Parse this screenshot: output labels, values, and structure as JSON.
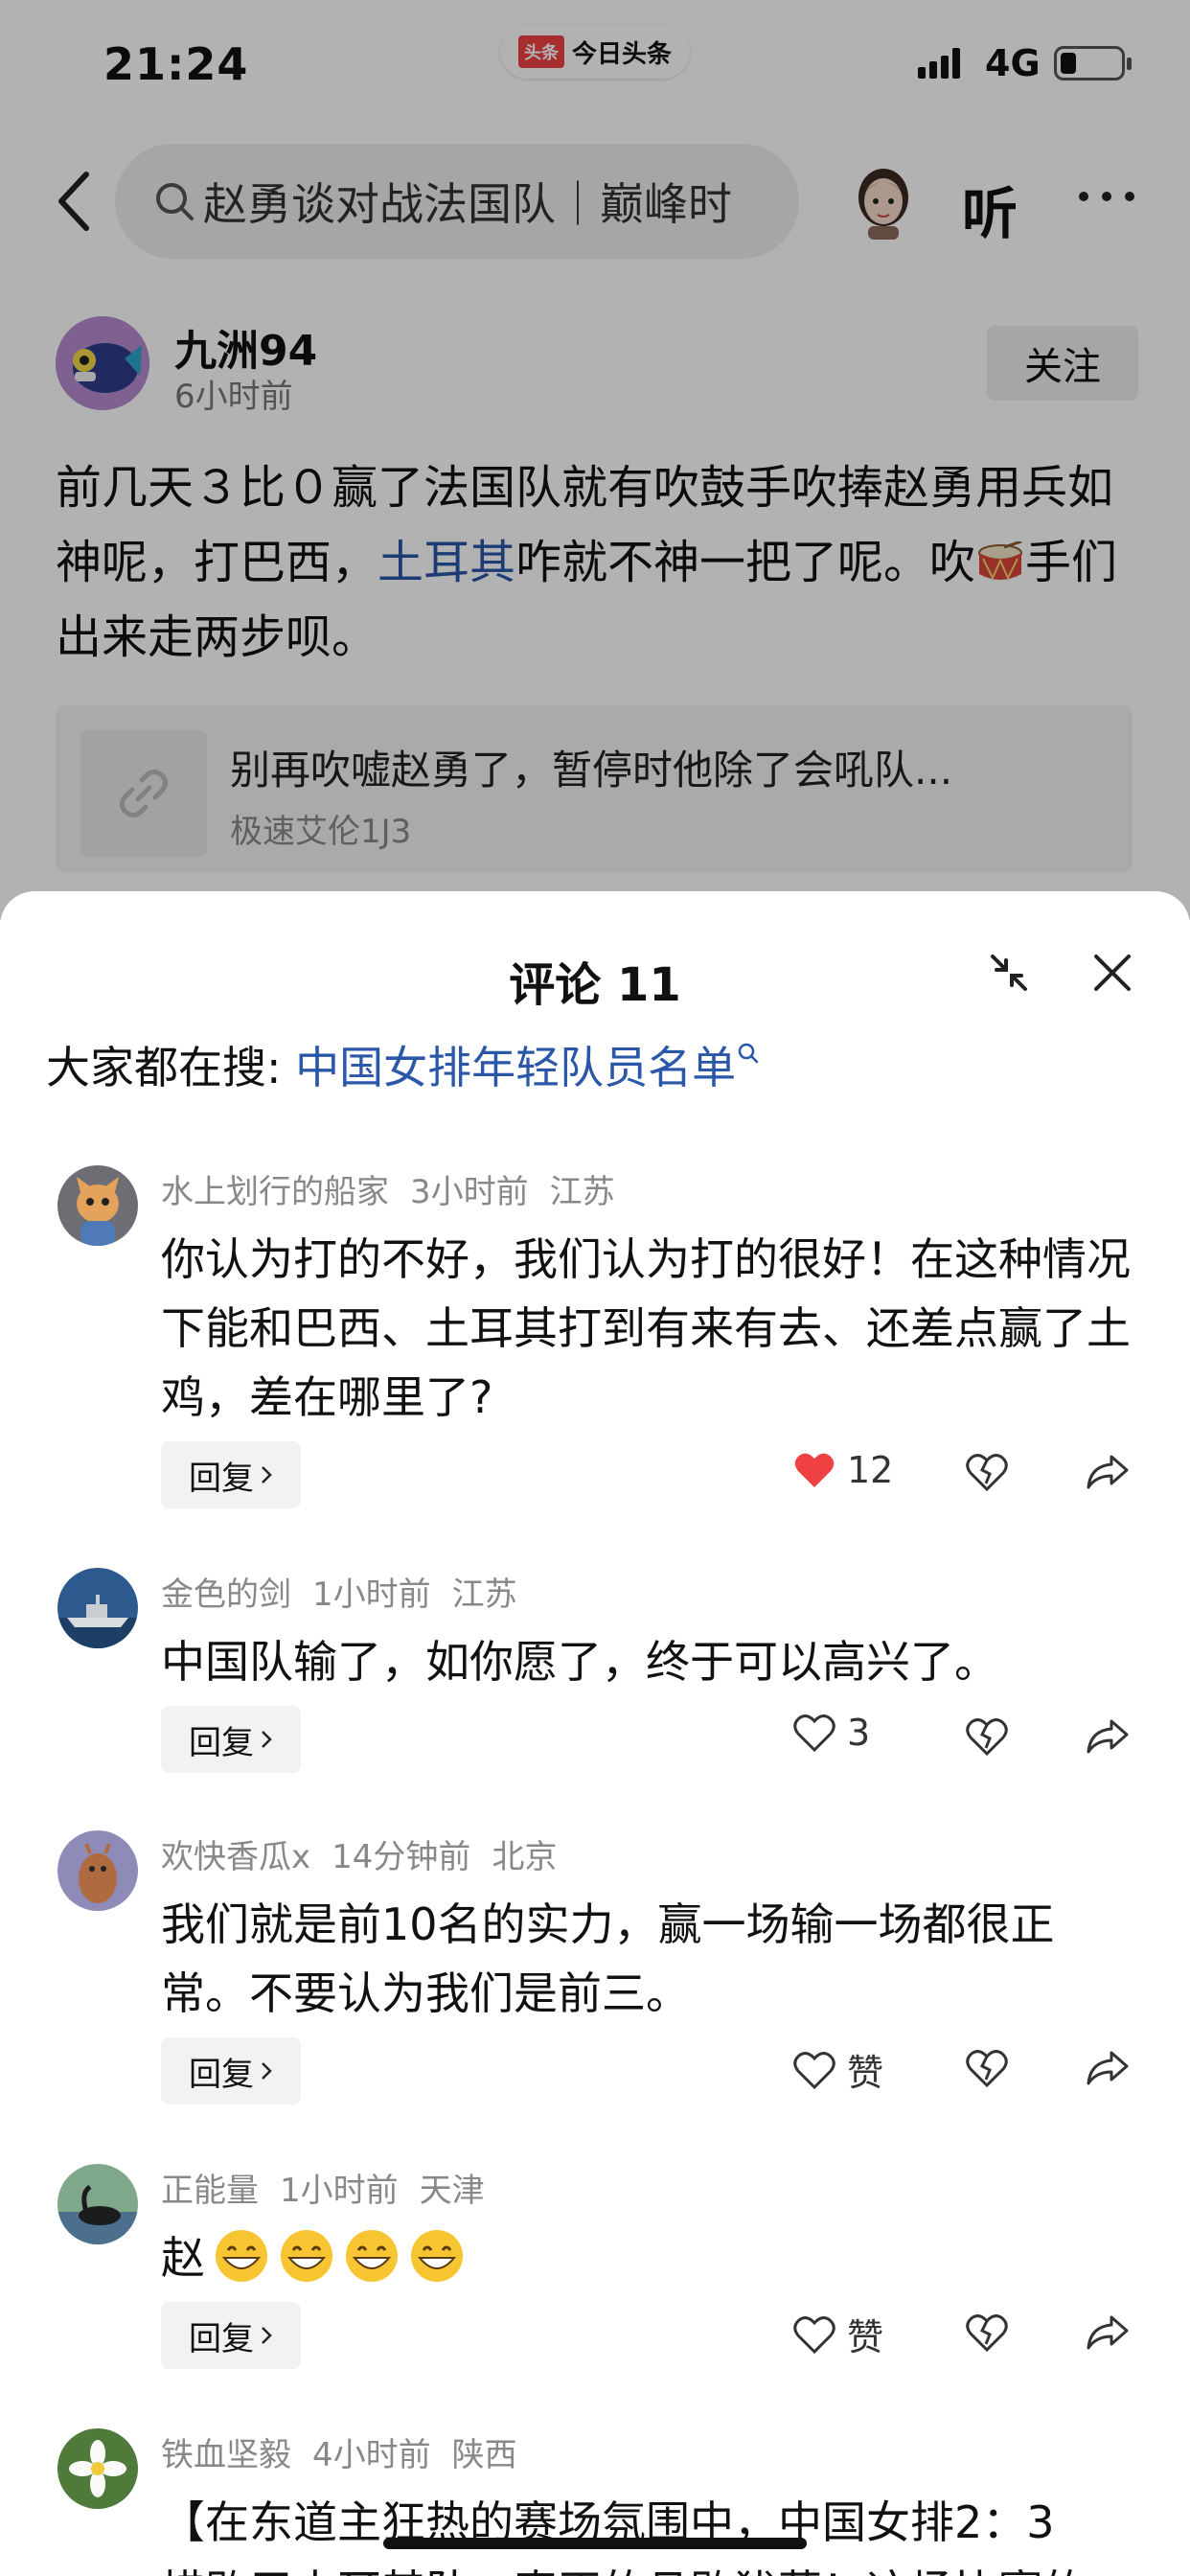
{
  "status_bar": {
    "time": "21:24",
    "app_logo": "头条",
    "app_name": "今日头条",
    "network": "4G",
    "battery_level": 0.2
  },
  "nav": {
    "search_text": "赵勇谈对战法国队｜巅峰时",
    "listen_label": "听",
    "icons": [
      "back-icon",
      "search-icon",
      "more-icon"
    ]
  },
  "post": {
    "author_name": "九洲94",
    "time": "6小时前",
    "follow_label": "关注",
    "text_part1": "前几天３比０赢了法国队就有吹鼓手吹捧赵勇用兵如神呢，打巴西，",
    "link_text": "土耳其",
    "text_part2": "咋就不神一把了呢。吹",
    "text_part3": "手们出来走两步呗。",
    "card_title": "别再吹嘘赵勇了，暂停时他除了会吼队...",
    "card_source": "极速艾伦1J3"
  },
  "sheet": {
    "title": "评论 11",
    "hot_search_prefix": "大家都在搜: ",
    "hot_search_query": "中国女排年轻队员名单",
    "reply_label": "回复",
    "like_placeholder": "赞",
    "accent_color": "#2a57a8",
    "like_active_color": "#f04142"
  },
  "comments": [
    {
      "user": "水上划行的船家",
      "time": "3小时前",
      "location": "江苏",
      "text": "你认为打的不好，我们认为打的很好！在这种情况下能和巴西、土耳其打到有来有去、还差点赢了土鸡，差在哪里了?",
      "likes": "12",
      "liked": true
    },
    {
      "user": "金色的剑",
      "time": "1小时前",
      "location": "江苏",
      "text": "中国队输了，如你愿了，终于可以高兴了。",
      "likes": "3",
      "liked": false
    },
    {
      "user": "欢快香瓜x",
      "time": "14分钟前",
      "location": "北京",
      "text": "我们就是前10名的实力，赢一场输一场都很正常。不要认为我们是前三。",
      "likes": "赞",
      "liked": false
    },
    {
      "user": "正能量",
      "time": "1小时前",
      "location": "天津",
      "text": "赵",
      "likes": "赞",
      "liked": false
    },
    {
      "user": "铁血坚毅",
      "time": "4小时前",
      "location": "陕西",
      "text": "【在东道主狂热的赛场氛围中，中国女排2：3",
      "text_line2": "惜败于土耳其队，真正的且败犹荣！这场比赛的"
    }
  ]
}
